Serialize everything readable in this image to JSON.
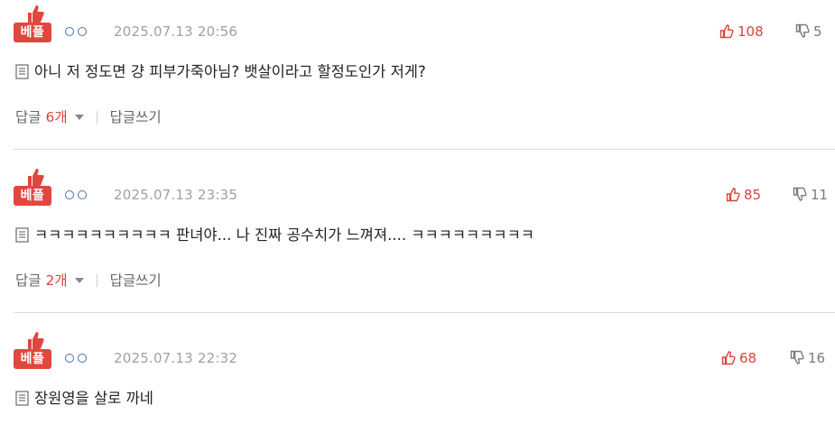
{
  "comments": [
    {
      "badge": "베플",
      "date": "2025.07.13 20:56",
      "likes": "108",
      "dislikes": "5",
      "text": "아니 저 정도면 걍 피부가죽아님? 뱃살이라고 할정도인가 저게?",
      "reply_label": "답글",
      "reply_count": "6개",
      "write_label": "답글쓰기"
    },
    {
      "badge": "베플",
      "date": "2025.07.13 23:35",
      "likes": "85",
      "dislikes": "11",
      "text": "ㅋㅋㅋㅋㅋㅋㅋㅋㅋㅋ 판녀야... 나 진짜 공수치가 느껴져.... ㅋㅋㅋㅋㅋㅋㅋㅋㅋ",
      "reply_label": "답글",
      "reply_count": "2개",
      "write_label": "답글쓰기"
    },
    {
      "badge": "베플",
      "date": "2025.07.13 22:32",
      "likes": "68",
      "dislikes": "16",
      "text": "장원영을 살로 까네"
    }
  ],
  "colors": {
    "badge_red": "#e0473f",
    "like_red": "#d8453a",
    "nick_blue": "#4a6fb5"
  },
  "icons": [
    "thumbs-up-icon",
    "thumb-up-outline-icon",
    "thumb-down-outline-icon",
    "document-icon",
    "caret-down-icon"
  ]
}
